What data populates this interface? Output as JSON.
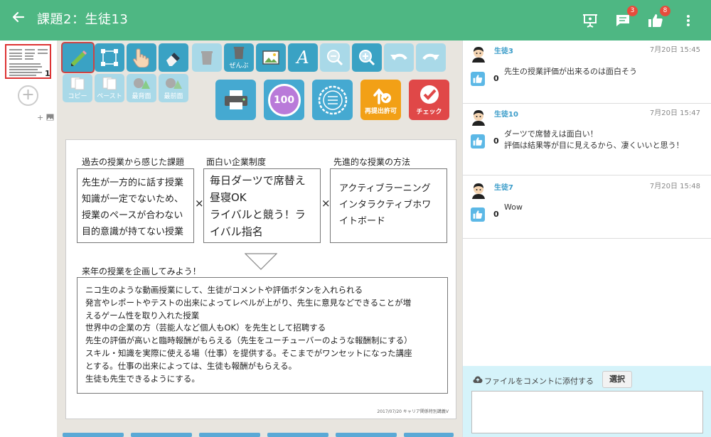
{
  "header": {
    "back_icon": "arrow-left-icon",
    "title": "課題2：生徒13",
    "comment_badge": "3",
    "like_badge": "8"
  },
  "sidebar": {
    "page_number": "1"
  },
  "toolbar": {
    "delete_all_label": "ぜんぶ",
    "copy_label": "コピー",
    "paste_label": "ペースト",
    "back_label": "最背面",
    "front_label": "最前面",
    "score_label": "100",
    "resubmit_label": "再提出許可",
    "check_label": "チェック"
  },
  "canvas": {
    "col1_header": "過去の授業から感じた課題",
    "col2_header": "面白い企業制度",
    "col3_header": "先進的な授業の方法",
    "col1_lines": [
      "先生が一方的に話す授業",
      "知識が一定でないため、",
      "授業のペースが合わない",
      "目的意識が持てない授業"
    ],
    "col2_lines": [
      "毎日ダーツで席替え",
      "昼寝OK",
      "ライバルと競う！ラ",
      "イバル指名"
    ],
    "col3_lines": [
      "アクティブラーニング",
      "インタラクティブホワ",
      "イトボード"
    ],
    "times_symbol": "×",
    "plan_header": "来年の授業を企画してみよう！",
    "plan_lines": [
      "ニコ生のような動画授業にして、生徒がコメントや評価ボタンを入れられる",
      "発言やレポートやテストの出来によってレベルが上がり、先生に意見などできることが増",
      "えるゲーム性を取り入れた授業",
      "世界中の企業の方（芸能人など個人もOK）を先生として招聘する",
      "先生の評価が高いと臨時報酬がもらえる（先生をユーチューバーのような報酬制にする）",
      "スキル・知識を実際に使える場（仕事）を提供する。そこまでがワンセットになった講座",
      "とする。仕事の出来によっては、生徒も報酬がもらえる。",
      "生徒も先生できるようにする。"
    ],
    "credit": "2017/07/20 キャリア関係特別講義V"
  },
  "comments": [
    {
      "name": "生徒3",
      "date": "7月20日 15:45",
      "likes": "0",
      "lines": [
        "先生の授業評価が出来るのは面白そう"
      ]
    },
    {
      "name": "生徒10",
      "date": "7月20日 15:47",
      "likes": "0",
      "lines": [
        "ダーツで席替えは面白い！",
        "評価は結果等が目に見えるから、凄くいいと思う！"
      ]
    },
    {
      "name": "生徒7",
      "date": "7月20日 15:48",
      "likes": "0",
      "lines": [
        "Wow"
      ]
    }
  ],
  "attach": {
    "label": "ファイルをコメントに添付する",
    "select_label": "選択",
    "input_value": ""
  },
  "colors": {
    "header": "#4eb783",
    "accent_blue": "#3a9cc9",
    "badge": "#e74c3c",
    "attach_bg": "#d5f3fa"
  }
}
